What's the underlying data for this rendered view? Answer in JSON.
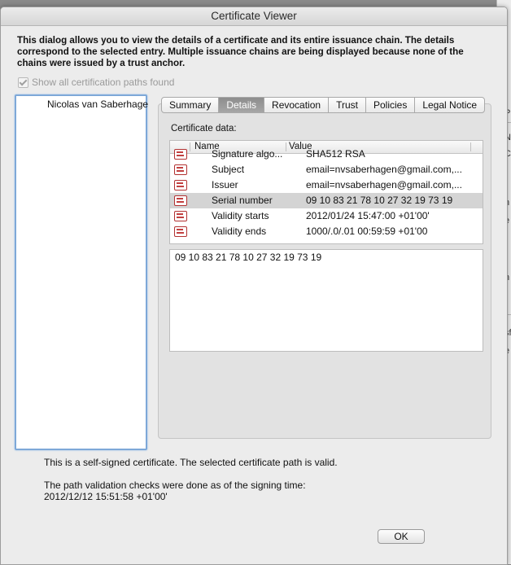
{
  "window": {
    "title": "Certificate Viewer"
  },
  "intro_text": "This dialog allows you to view the details of a certificate and its entire issuance chain. The details correspond to the selected entry. Multiple issuance chains are being displayed because none of the chains were issued by a trust anchor.",
  "show_all": {
    "label": "Show all certification paths found",
    "checked": true,
    "enabled": false
  },
  "path_list": {
    "items": [
      "Nicolas van Saberhage"
    ]
  },
  "tabs": [
    {
      "label": "Summary",
      "active": false
    },
    {
      "label": "Details",
      "active": true
    },
    {
      "label": "Revocation",
      "active": false
    },
    {
      "label": "Trust",
      "active": false
    },
    {
      "label": "Policies",
      "active": false
    },
    {
      "label": "Legal Notice",
      "active": false
    }
  ],
  "details": {
    "cert_data_label": "Certificate data:",
    "columns": {
      "name": "Name",
      "value": "Value"
    },
    "rows": [
      {
        "name": "Signature algo...",
        "value": "SHA512 RSA",
        "selected": false
      },
      {
        "name": "Subject",
        "value": "email=nvsaberhagen@gmail.com,...",
        "selected": false
      },
      {
        "name": "Issuer",
        "value": "email=nvsaberhagen@gmail.com,...",
        "selected": false
      },
      {
        "name": "Serial number",
        "value": "09 10 83 21 78 10 27 32 19 73 19",
        "selected": true
      },
      {
        "name": "Validity starts",
        "value": "2012/01/24 15:47:00 +01'00'",
        "selected": false
      },
      {
        "name": "Validity ends",
        "value": "1000/.0/.01 00:59:59 +01'00",
        "selected": false
      }
    ],
    "selected_value": "09 10 83 21 78 10 27 32 19 73 19"
  },
  "status": {
    "text": "This is a self-signed certificate. The selected certificate path is valid.",
    "validation_line1": "The path validation checks were done as of the signing time:",
    "validation_line2": "2012/12/12 15:51:58 +01'00'"
  },
  "ok_button": {
    "label": "OK"
  },
  "background_app": {
    "fragments": [
      "P",
      "N",
      "C",
      "n",
      "e",
      "n",
      "sf",
      "e"
    ]
  }
}
